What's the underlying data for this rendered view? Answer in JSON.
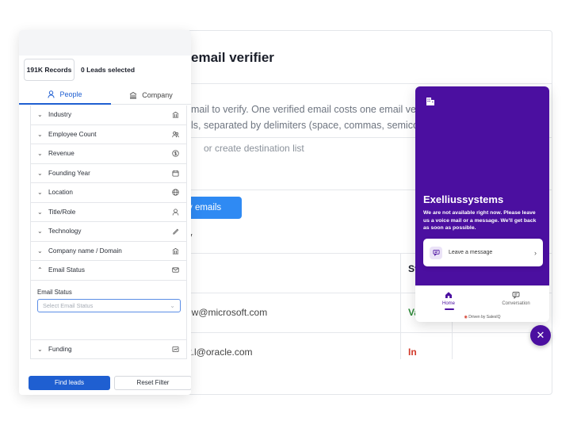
{
  "verifier": {
    "title": "email verifier",
    "description_line1": "mail to verify. One verified email costs one email veri",
    "description_line2": "ls, separated by delimiters (space, commas, semicolo",
    "destination_hint": "or create destination list",
    "verify_button": "y emails",
    "section_label": "y",
    "status_header": "St",
    "rows": [
      {
        "email": "t.w@microsoft.com",
        "status": "Va",
        "status_color": "#2e8b3a"
      },
      {
        "email": "tt.l@oracle.com",
        "status": "In",
        "status_color": "#d23a2a"
      }
    ]
  },
  "filters": {
    "records": "191K Records",
    "leads_selected": "0 Leads selected",
    "tabs": [
      {
        "label": "People",
        "icon": "person-icon"
      },
      {
        "label": "Company",
        "icon": "building-icon"
      }
    ],
    "items": [
      {
        "label": "Industry",
        "icon": "bank-icon"
      },
      {
        "label": "Employee Count",
        "icon": "people-icon"
      },
      {
        "label": "Revenue",
        "icon": "dollar-icon"
      },
      {
        "label": "Founding Year",
        "icon": "calendar-icon"
      },
      {
        "label": "Location",
        "icon": "globe-icon"
      },
      {
        "label": "Title/Role",
        "icon": "user-icon"
      },
      {
        "label": "Technology",
        "icon": "pen-icon"
      },
      {
        "label": "Company name / Domain",
        "icon": "bank-icon"
      },
      {
        "label": "Email Status",
        "icon": "mail-icon"
      }
    ],
    "email_status": {
      "label": "Email Status",
      "placeholder": "Select Email Status"
    },
    "funding": {
      "label": "Funding",
      "icon": "chart-icon"
    },
    "find_button": "Find leads",
    "reset_button": "Reset Filter"
  },
  "chat": {
    "company": "Exelliussystems",
    "message": "We are not available right now. Please leave us a voice mail or a message. We'll get back as soon as possible.",
    "leave_message": "Leave a message",
    "nav_home": "Home",
    "nav_conversation": "Conversation",
    "driven_by": "Driven by SalesIQ",
    "accent": "#4b0fa0"
  }
}
